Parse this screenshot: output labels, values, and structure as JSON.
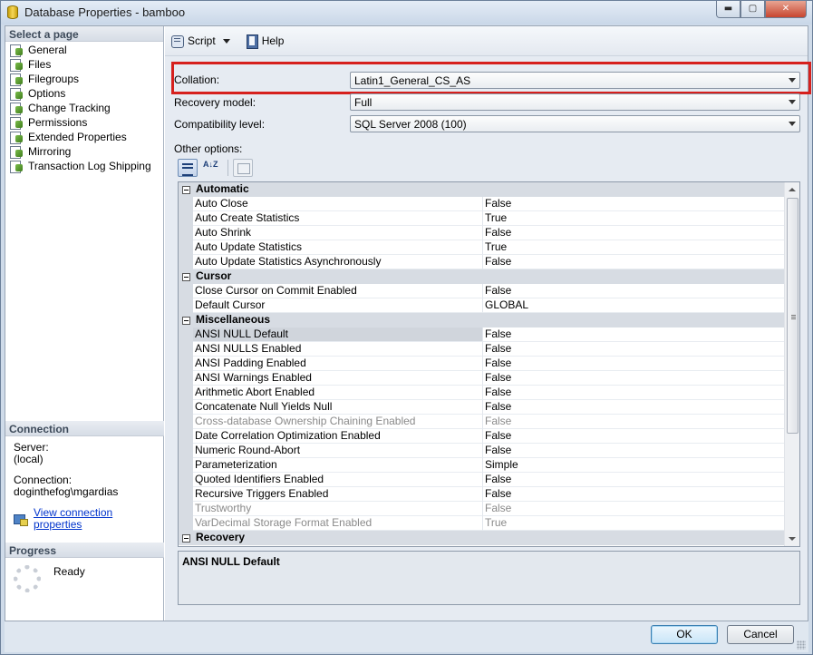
{
  "window": {
    "title": "Database Properties - bamboo",
    "minimize": "▬",
    "maximize": "▢",
    "close": "✕"
  },
  "left": {
    "select_header": "Select a page",
    "pages": [
      {
        "label": "General"
      },
      {
        "label": "Files"
      },
      {
        "label": "Filegroups"
      },
      {
        "label": "Options"
      },
      {
        "label": "Change Tracking"
      },
      {
        "label": "Permissions"
      },
      {
        "label": "Extended Properties"
      },
      {
        "label": "Mirroring"
      },
      {
        "label": "Transaction Log Shipping"
      }
    ],
    "selected_page": "Options",
    "connection_header": "Connection",
    "server_label": "Server:",
    "server_value": "(local)",
    "connection_label": "Connection:",
    "connection_value": "doginthefog\\mgardias",
    "view_link": "View connection properties",
    "progress_header": "Progress",
    "progress_status": "Ready"
  },
  "toolbar": {
    "script_label": "Script",
    "help_label": "Help"
  },
  "form": {
    "collation_label": "Collation:",
    "collation_value": "Latin1_General_CS_AS",
    "recovery_label": "Recovery model:",
    "recovery_value": "Full",
    "compat_label": "Compatibility level:",
    "compat_value": "SQL Server 2008 (100)",
    "other_label": "Other options:"
  },
  "grid_tools": {
    "alpha_icon": "A↓Z"
  },
  "grid": {
    "categories": [
      {
        "name": "Automatic",
        "props": [
          {
            "name": "Auto Close",
            "value": "False"
          },
          {
            "name": "Auto Create Statistics",
            "value": "True"
          },
          {
            "name": "Auto Shrink",
            "value": "False"
          },
          {
            "name": "Auto Update Statistics",
            "value": "True"
          },
          {
            "name": "Auto Update Statistics Asynchronously",
            "value": "False"
          }
        ]
      },
      {
        "name": "Cursor",
        "props": [
          {
            "name": "Close Cursor on Commit Enabled",
            "value": "False"
          },
          {
            "name": "Default Cursor",
            "value": "GLOBAL"
          }
        ]
      },
      {
        "name": "Miscellaneous",
        "props": [
          {
            "name": "ANSI NULL Default",
            "value": "False",
            "selected": true
          },
          {
            "name": "ANSI NULLS Enabled",
            "value": "False"
          },
          {
            "name": "ANSI Padding Enabled",
            "value": "False"
          },
          {
            "name": "ANSI Warnings Enabled",
            "value": "False"
          },
          {
            "name": "Arithmetic Abort Enabled",
            "value": "False"
          },
          {
            "name": "Concatenate Null Yields Null",
            "value": "False"
          },
          {
            "name": "Cross-database Ownership Chaining Enabled",
            "value": "False",
            "disabled": true
          },
          {
            "name": "Date Correlation Optimization Enabled",
            "value": "False"
          },
          {
            "name": "Numeric Round-Abort",
            "value": "False"
          },
          {
            "name": "Parameterization",
            "value": "Simple"
          },
          {
            "name": "Quoted Identifiers Enabled",
            "value": "False"
          },
          {
            "name": "Recursive Triggers Enabled",
            "value": "False"
          },
          {
            "name": "Trustworthy",
            "value": "False",
            "disabled": true
          },
          {
            "name": "VarDecimal Storage Format Enabled",
            "value": "True",
            "disabled": true
          }
        ]
      },
      {
        "name": "Recovery",
        "props": []
      }
    ]
  },
  "description": {
    "title": "ANSI NULL Default"
  },
  "footer": {
    "ok_label": "OK",
    "cancel_label": "Cancel"
  },
  "colors": {
    "highlight": "#d6201d",
    "link": "#0033cc"
  }
}
